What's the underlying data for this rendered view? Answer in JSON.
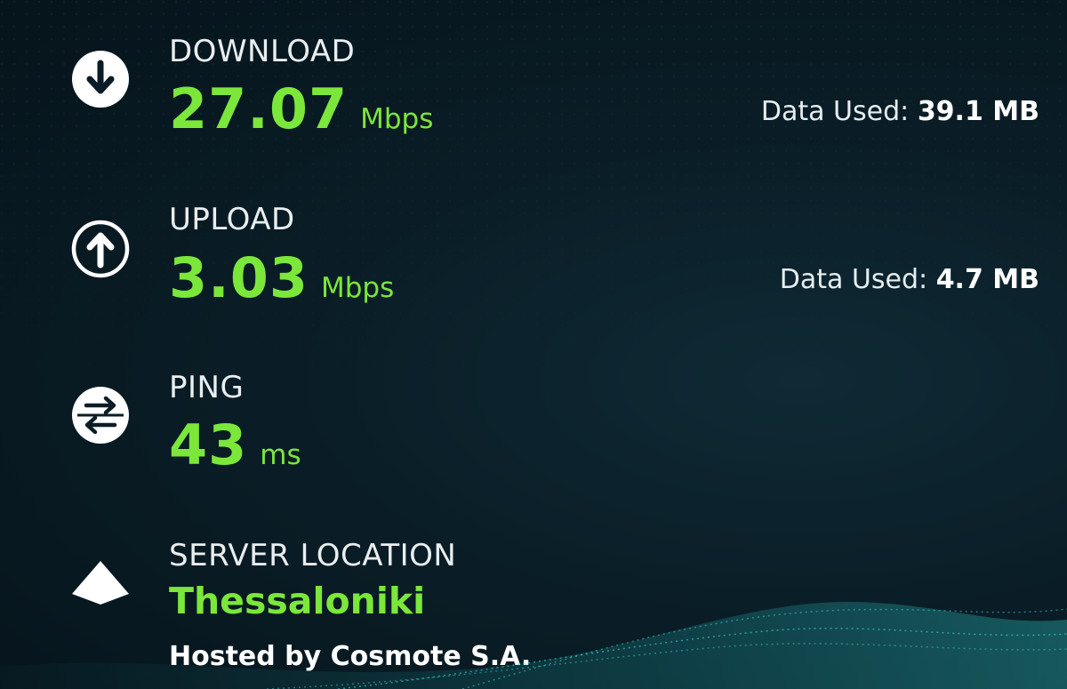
{
  "download": {
    "label": "DOWNLOAD",
    "value": "27.07",
    "unit": "Mbps",
    "data_used_label": "Data Used:",
    "data_used_value": "39.1 MB",
    "icon": "arrow-down-circle-icon"
  },
  "upload": {
    "label": "UPLOAD",
    "value": "3.03",
    "unit": "Mbps",
    "data_used_label": "Data Used:",
    "data_used_value": "4.7 MB",
    "icon": "arrow-up-circle-icon"
  },
  "ping": {
    "label": "PING",
    "value": "43",
    "unit": "ms",
    "icon": "ping-arrows-circle-icon"
  },
  "server": {
    "label": "SERVER LOCATION",
    "name": "Thessaloniki",
    "hosted_by": "Hosted by Cosmote S.A.",
    "icon": "location-pin-icon"
  },
  "colors": {
    "accent": "#7be73a",
    "background": "#0a1d26",
    "text": "#ffffff"
  }
}
